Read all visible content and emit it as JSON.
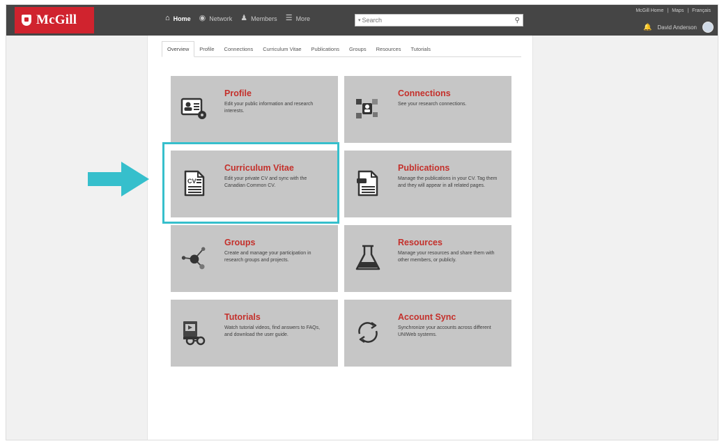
{
  "brand": {
    "name": "McGill",
    "color": "#d0232e"
  },
  "nav": [
    {
      "label": "Home",
      "icon": "home-icon",
      "active": true
    },
    {
      "label": "Network",
      "icon": "network-icon",
      "active": false
    },
    {
      "label": "Members",
      "icon": "members-icon",
      "active": false
    },
    {
      "label": "More",
      "icon": "menu-icon",
      "active": false
    }
  ],
  "search": {
    "placeholder": "Search",
    "scope_icon": "caret-down-icon"
  },
  "toplinks": [
    "McGill Home",
    "|",
    "Maps",
    "|",
    "Français"
  ],
  "user": {
    "name": "David Anderson",
    "notification_icon": "bell-icon"
  },
  "tabs": [
    "Overview",
    "Profile",
    "Connections",
    "Curriculum Vitae",
    "Publications",
    "Groups",
    "Resources",
    "Tutorials"
  ],
  "active_tab": "Overview",
  "cards": {
    "profile": {
      "title": "Profile",
      "desc": "Edit your public information and research interests.",
      "icon": "profile-card-icon"
    },
    "connections": {
      "title": "Connections",
      "desc": "See your research connections.",
      "icon": "connections-icon"
    },
    "cv": {
      "title": "Curriculum Vitae",
      "desc": "Edit your private CV and sync with the Canadian Common CV.",
      "icon": "cv-document-icon"
    },
    "publications": {
      "title": "Publications",
      "desc": "Manage the publications in your CV. Tag them and they will appear in all related pages.",
      "icon": "publication-document-icon"
    },
    "groups": {
      "title": "Groups",
      "desc": "Create and manage your participation in research groups and projects.",
      "icon": "groups-network-icon"
    },
    "resources": {
      "title": "Resources",
      "desc": "Manage your resources and share them with other members, or publicly.",
      "icon": "flask-icon"
    },
    "tutorials": {
      "title": "Tutorials",
      "desc": "Watch tutorial videos, find answers to FAQs, and download the user guide.",
      "icon": "tutorials-icon"
    },
    "accountsync": {
      "title": "Account Sync",
      "desc": "Synchronize your accounts across different UNIWeb systems.",
      "icon": "sync-icon"
    }
  },
  "colors": {
    "topbar": "#454545",
    "card_bg": "#c6c6c6",
    "card_title": "#c4302b",
    "highlight": "#36bfcc"
  },
  "annotation": {
    "highlighted_card": "Curriculum Vitae",
    "pointer": "arrow-right-icon"
  }
}
